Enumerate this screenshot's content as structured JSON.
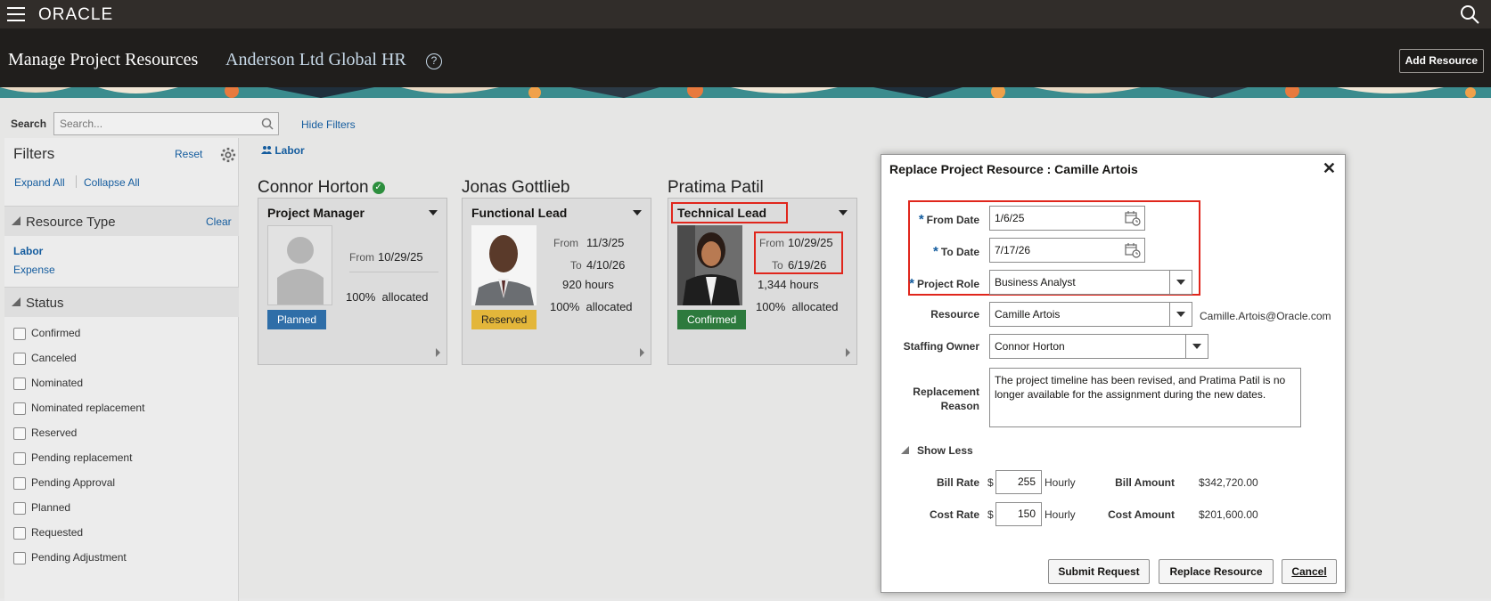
{
  "app": {
    "logo": "ORACLE"
  },
  "header": {
    "title": "Manage Project Resources",
    "project": "Anderson Ltd Global HR",
    "add_resource": "Add Resource"
  },
  "search": {
    "label": "Search",
    "placeholder": "Search...",
    "hide_filters": "Hide Filters"
  },
  "filters": {
    "title": "Filters",
    "reset": "Reset",
    "expand_all": "Expand All",
    "collapse_all": "Collapse All",
    "resource_type": {
      "title": "Resource Type",
      "clear": "Clear",
      "items": [
        "Labor",
        "Expense"
      ]
    },
    "status": {
      "title": "Status",
      "items": [
        "Confirmed",
        "Canceled",
        "Nominated",
        "Nominated replacement",
        "Reserved",
        "Pending replacement",
        "Pending Approval",
        "Planned",
        "Requested",
        "Pending Adjustment"
      ]
    }
  },
  "labor_link": "Labor",
  "cards": [
    {
      "name": "Connor Horton",
      "role": "Project Manager",
      "from_label": "From",
      "from": "10/29/25",
      "to_label": "",
      "to": "",
      "hours": "",
      "allocation": "100%",
      "allocated_label": "allocated",
      "status": "Planned",
      "status_color": "#2f6ea8"
    },
    {
      "name": "Jonas Gottlieb",
      "role": "Functional Lead",
      "from_label": "From",
      "from": "11/3/25",
      "to_label": "To",
      "to": "4/10/26",
      "hours": "920 hours",
      "allocation": "100%",
      "allocated_label": "allocated",
      "status": "Reserved",
      "status_color": "#e3b63a"
    },
    {
      "name": "Pratima Patil",
      "role": "Technical Lead",
      "from_label": "From",
      "from": "10/29/25",
      "to_label": "To",
      "to": "6/19/26",
      "hours": "1,344 hours",
      "allocation": "100%",
      "allocated_label": "allocated",
      "status": "Confirmed",
      "status_color": "#2d7a3d"
    }
  ],
  "dialog": {
    "title": "Replace Project Resource : Camille Artois",
    "close": "✕",
    "from_date_label": "From Date",
    "from_date": "1/6/25",
    "to_date_label": "To Date",
    "to_date": "7/17/26",
    "project_role_label": "Project Role",
    "project_role": "Business Analyst",
    "resource_label": "Resource",
    "resource": "Camille Artois",
    "resource_email": "Camille.Artois@Oracle.com",
    "staffing_owner_label": "Staffing Owner",
    "staffing_owner": "Connor Horton",
    "replacement_reason_label_1": "Replacement",
    "replacement_reason_label_2": "Reason",
    "replacement_reason": "The project timeline has been revised, and Pratima Patil is no longer available for the assignment during the new dates.",
    "show_less": "Show Less",
    "bill_rate_label": "Bill Rate",
    "bill_rate": "255",
    "currency": "$",
    "hourly": "Hourly",
    "bill_amount_label": "Bill Amount",
    "bill_amount": "$342,720.00",
    "cost_rate_label": "Cost Rate",
    "cost_rate": "150",
    "cost_amount_label": "Cost Amount",
    "cost_amount": "$201,600.00",
    "submit_request": "Submit Request",
    "replace_resource": "Replace Resource",
    "cancel": "Cancel"
  }
}
